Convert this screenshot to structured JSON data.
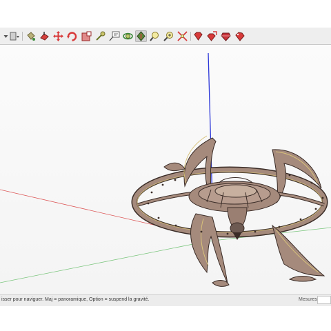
{
  "statusbar": {
    "hint_text": "isser pour naviguer. Maj = panoramique, Option =  suspend la gravité.",
    "measure_label": "Mesures",
    "measure_value": ""
  },
  "toolbar": {
    "tools": [
      {
        "name": "dropdown-arrow-icon"
      },
      {
        "name": "select-dropdown-icon"
      },
      {
        "name": "paint-bucket-icon"
      },
      {
        "name": "push-pull-icon"
      },
      {
        "name": "move-icon"
      },
      {
        "name": "rotate-icon"
      },
      {
        "name": "scale-icon"
      },
      {
        "name": "tape-measure-icon"
      },
      {
        "name": "text-label-icon"
      },
      {
        "name": "orbit-icon"
      },
      {
        "name": "walk-icon"
      },
      {
        "name": "look-around-icon"
      },
      {
        "name": "zoom-icon"
      },
      {
        "name": "zoom-extents-icon"
      },
      {
        "name": "gem-icon"
      },
      {
        "name": "gem-share-icon"
      },
      {
        "name": "ruby-icon"
      },
      {
        "name": "extension-warehouse-icon"
      }
    ],
    "active_tool": "look-around-icon"
  },
  "colors": {
    "toolbar_bg": "#eeeeee",
    "viewport_bg": "#f6f6f6",
    "axis_blue": "#2a35d8",
    "axis_red": "#d83a3a",
    "axis_green": "#47b24a",
    "model_fill": "#a58a7c",
    "model_outline": "#3a2c27",
    "model_accent": "#d8c27a"
  }
}
